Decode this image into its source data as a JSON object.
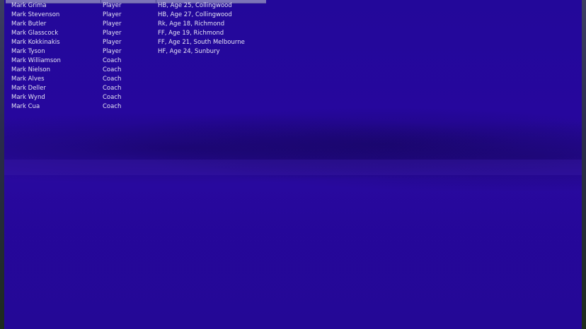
{
  "colors": {
    "background": "#23089a",
    "text": "#e4e2f4",
    "header_strip": "#7c74b8"
  },
  "results": [
    {
      "name": "Mark Grima",
      "role": "Player",
      "info": "HB, Age 25, Collingwood"
    },
    {
      "name": "Mark Stevenson",
      "role": "Player",
      "info": "HB, Age 27, Collingwood"
    },
    {
      "name": "Mark Butler",
      "role": "Player",
      "info": "Rk, Age 18, Richmond"
    },
    {
      "name": "Mark Glasscock",
      "role": "Player",
      "info": "FF, Age 19, Richmond"
    },
    {
      "name": "Mark Kokkinakis",
      "role": "Player",
      "info": "FF, Age 21, South Melbourne"
    },
    {
      "name": "Mark Tyson",
      "role": "Player",
      "info": "HF, Age 24, Sunbury"
    },
    {
      "name": "Mark Williamson",
      "role": "Coach",
      "info": ""
    },
    {
      "name": "Mark Nielson",
      "role": "Coach",
      "info": ""
    },
    {
      "name": "Mark Alves",
      "role": "Coach",
      "info": ""
    },
    {
      "name": "Mark Deller",
      "role": "Coach",
      "info": ""
    },
    {
      "name": "Mark Wynd",
      "role": "Coach",
      "info": ""
    },
    {
      "name": "Mark Cua",
      "role": "Coach",
      "info": ""
    }
  ]
}
